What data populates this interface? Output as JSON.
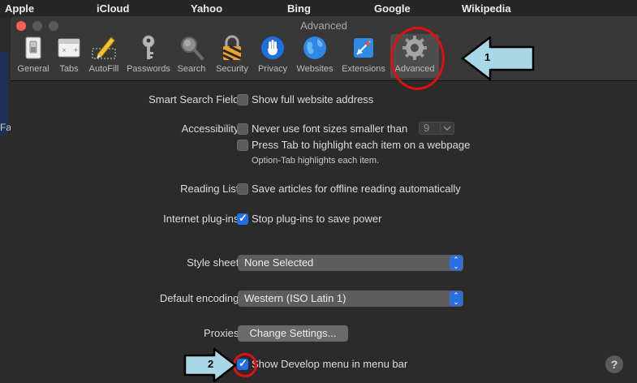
{
  "bookmarks": [
    "Apple",
    "iCloud",
    "Yahoo",
    "Bing",
    "Google",
    "Wikipedia"
  ],
  "side_text": "Fa",
  "window_title": "Advanced",
  "toolbar": [
    {
      "label": "General",
      "icon": "switch-icon"
    },
    {
      "label": "Tabs",
      "icon": "tabs-icon"
    },
    {
      "label": "AutoFill",
      "icon": "pencil-icon"
    },
    {
      "label": "Passwords",
      "icon": "key-icon"
    },
    {
      "label": "Search",
      "icon": "magnifier-icon"
    },
    {
      "label": "Security",
      "icon": "lock-icon"
    },
    {
      "label": "Privacy",
      "icon": "hand-icon"
    },
    {
      "label": "Websites",
      "icon": "globe-icon"
    },
    {
      "label": "Extensions",
      "icon": "puzzle-icon"
    },
    {
      "label": "Advanced",
      "icon": "gear-icon",
      "selected": true
    }
  ],
  "settings": {
    "smart_search": {
      "label": "Smart Search Field:",
      "option": "Show full website address",
      "checked": false
    },
    "accessibility": {
      "label": "Accessibility:",
      "option1": "Never use font sizes smaller than",
      "font_size": "9",
      "option2": "Press Tab to highlight each item on a webpage",
      "hint": "Option-Tab highlights each item."
    },
    "reading_list": {
      "label": "Reading List:",
      "option": "Save articles for offline reading automatically",
      "checked": false
    },
    "plugins": {
      "label": "Internet plug-ins:",
      "option": "Stop plug-ins to save power",
      "checked": true
    },
    "style_sheet": {
      "label": "Style sheet:",
      "value": "None Selected"
    },
    "encoding": {
      "label": "Default encoding:",
      "value": "Western (ISO Latin 1)"
    },
    "proxies": {
      "label": "Proxies:",
      "button": "Change Settings..."
    },
    "develop": {
      "option": "Show Develop menu in menu bar",
      "checked": true
    }
  },
  "help_label": "?",
  "annotations": {
    "arrow1_number": "1",
    "arrow2_number": "2",
    "arrow_color": "#a8d8e6",
    "circle_color": "#e01010"
  }
}
